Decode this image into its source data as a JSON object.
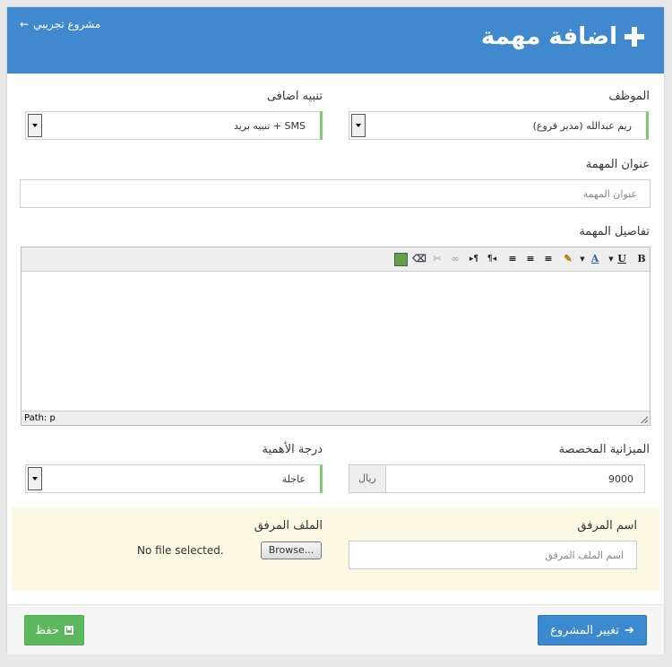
{
  "header": {
    "title": "اضافة مهمة",
    "back_link": "مشروع تجريبي"
  },
  "form": {
    "employee": {
      "label": "الموظف",
      "value": "ريم عبدالله (مدير فروع)"
    },
    "alert": {
      "label": "تنبيه اضافى",
      "value": "SMS + تنبيه بريد"
    },
    "task_title": {
      "label": "عنوان المهمة",
      "placeholder": "عنوان المهمة"
    },
    "task_details": {
      "label": "تفاصيل المهمة",
      "path": "Path: p"
    },
    "budget": {
      "label": "الميزانية المخصصة",
      "value": "9000",
      "currency": "ريال"
    },
    "priority": {
      "label": "درجة الأهمية",
      "value": "عاجلة"
    },
    "attachment_name": {
      "label": "اسم المرفق",
      "placeholder": "اسم الملف المرفق"
    },
    "attachment_file": {
      "label": "الملف المرفق",
      "browse": "Browse...",
      "status": "No file selected."
    }
  },
  "editor_toolbar": {
    "bold": "B",
    "underline": "U",
    "font_color": "A"
  },
  "footer": {
    "change_project": "تغيير المشروع",
    "save": "حفظ"
  },
  "colors": {
    "header_bg": "#4189cf",
    "required_edge": "#e08b8b",
    "valid_edge": "#7fc96f",
    "attach_bg": "#fcf8e3",
    "btn_blue": "#3b8ad0",
    "btn_green": "#5cb85c"
  }
}
